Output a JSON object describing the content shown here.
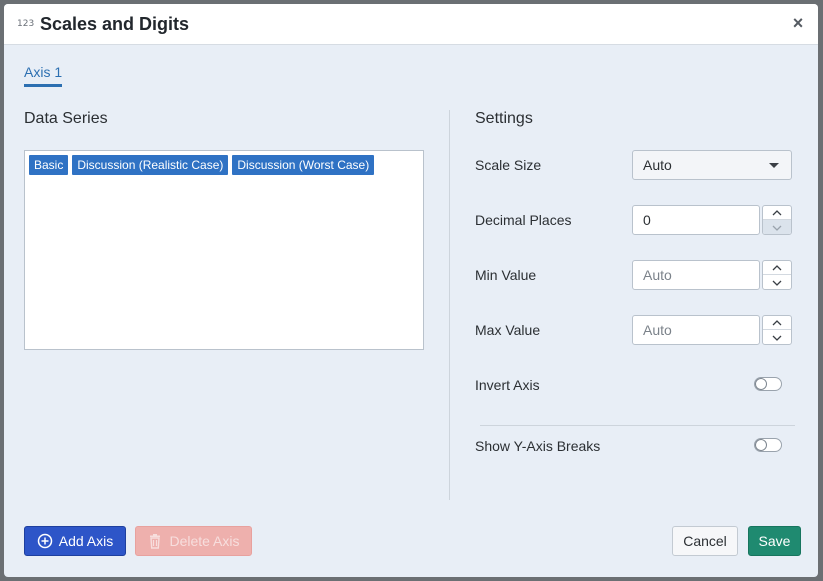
{
  "dialog": {
    "icon_text": "123",
    "title": "Scales and Digits",
    "close_glyph": "×"
  },
  "tabs": [
    {
      "label": "Axis 1",
      "active": true
    }
  ],
  "data_series": {
    "heading": "Data Series",
    "items": [
      "Basic",
      "Discussion (Realistic Case)",
      "Discussion (Worst Case)"
    ]
  },
  "settings": {
    "heading": "Settings",
    "scale_size": {
      "label": "Scale Size",
      "value": "Auto"
    },
    "decimal_places": {
      "label": "Decimal Places",
      "value": "0"
    },
    "min_value": {
      "label": "Min Value",
      "placeholder": "Auto"
    },
    "max_value": {
      "label": "Max Value",
      "placeholder": "Auto"
    },
    "invert_axis": {
      "label": "Invert Axis",
      "on": false
    },
    "show_breaks": {
      "label": "Show Y-Axis Breaks",
      "on": false
    }
  },
  "footer": {
    "add_axis": "Add Axis",
    "delete_axis": "Delete Axis",
    "cancel": "Cancel",
    "save": "Save"
  },
  "icons": {
    "title": "numbers-icon",
    "close": "close-icon",
    "add": "plus-circle-icon",
    "delete": "trash-icon",
    "dropdown": "caret-down-icon",
    "stepper_up": "chevron-up-icon",
    "stepper_down": "chevron-down-icon"
  },
  "colors": {
    "accent": "#2c6fb1",
    "chip": "#2f72c4",
    "add_button": "#2d55c8",
    "delete_button": "#eeb0ad",
    "save_button": "#1f8a70"
  }
}
